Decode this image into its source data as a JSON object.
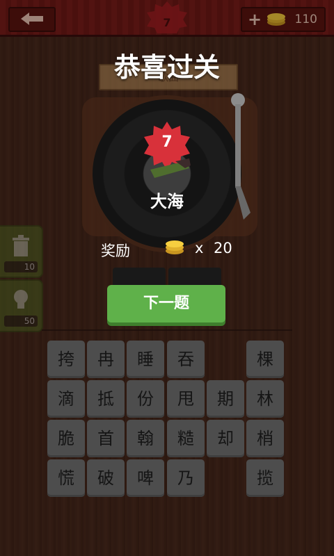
{
  "header": {
    "coins": "110",
    "level": "7"
  },
  "stage": {
    "label": "歌曲"
  },
  "hints": [
    {
      "cost": "10"
    },
    {
      "cost": "50"
    }
  ],
  "dialog": {
    "title": "恭喜过关",
    "level": "7",
    "song": "大海",
    "reward_label": "奖励",
    "reward_x": "x",
    "reward_amount": "20",
    "next_label": "下一题"
  },
  "grid": [
    [
      "挎",
      "冉",
      "睡",
      "吞",
      "",
      "棵"
    ],
    [
      "滴",
      "抵",
      "份",
      "甩",
      "期",
      "林"
    ],
    [
      "脆",
      "首",
      "翰",
      "糙",
      "却",
      "梢"
    ],
    [
      "慌",
      "破",
      "啤",
      "乃",
      "",
      "揽"
    ]
  ],
  "colors": {
    "accent_green": "#5fb14a",
    "badge_red": "#d8313a",
    "header_red": "#7a1d1a"
  }
}
